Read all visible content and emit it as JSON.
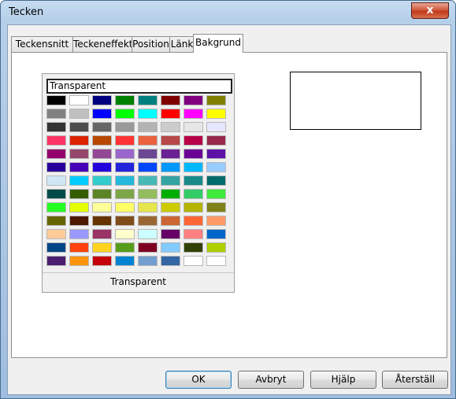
{
  "window": {
    "title": "Tecken",
    "close_glyph": "x"
  },
  "tabs": [
    "Teckensnitt",
    "Teckeneffekt",
    "Position",
    "Länk",
    "Bakgrund"
  ],
  "active_tab": "Bakgrund",
  "palette": {
    "selected_label": "Transparent",
    "bottom_label": "Transparent",
    "rows": [
      [
        "#000000",
        "#ffffff",
        "#000080",
        "#008000",
        "#008080",
        "#800000",
        "#800080",
        "#808000"
      ],
      [
        "#808080",
        "#c0c0c0",
        "#0000ff",
        "#00ff00",
        "#00ffff",
        "#ff0000",
        "#ff00ff",
        "#ffff00"
      ],
      [
        "#333333",
        "#4d4d4d",
        "#666666",
        "#999999",
        "#b3b3b3",
        "#cccccc",
        "#e6e6e6",
        "#e6e6ff"
      ],
      [
        "#ff3366",
        "#dc2300",
        "#b84700",
        "#ff3333",
        "#eb613d",
        "#b84747",
        "#b80047",
        "#99284c"
      ],
      [
        "#94006b",
        "#94476b",
        "#944794",
        "#9966cc",
        "#6b4794",
        "#6b2394",
        "#6b0094",
        "#5e11a6"
      ],
      [
        "#280099",
        "#4700b8",
        "#2300dc",
        "#2323dc",
        "#0047ff",
        "#0099ff",
        "#00b8ff",
        "#99ccff"
      ],
      [
        "#cfe7f5",
        "#00ccff",
        "#33cccc",
        "#23b8dc",
        "#47b8b8",
        "#33a3a3",
        "#198a8a",
        "#006b6b"
      ],
      [
        "#004a4a",
        "#355e00",
        "#5c8526",
        "#7da647",
        "#94bd5e",
        "#00ae00",
        "#33cc66",
        "#3deb3d"
      ],
      [
        "#23ff23",
        "#e6ff00",
        "#ffff99",
        "#ffff66",
        "#e6e64c",
        "#cccc00",
        "#b3b300",
        "#808019"
      ],
      [
        "#666600",
        "#4c1900",
        "#663300",
        "#804c19",
        "#996633",
        "#cc6633",
        "#ff6633",
        "#ff9966"
      ],
      [
        "#ffcc99",
        "#9999ff",
        "#993366",
        "#ffffcc",
        "#ccffff",
        "#660066",
        "#ff8080",
        "#0066cc"
      ],
      [
        "#004586",
        "#ff420e",
        "#ffd320",
        "#579d1c",
        "#7e0021",
        "#83caff",
        "#314004",
        "#aecf00"
      ],
      [
        "#4b1f6f",
        "#ff950e",
        "#c5000b",
        "#0084d1",
        "#729fcf",
        "#3465a4",
        "#ffffff",
        "#ffffff"
      ]
    ]
  },
  "buttons": {
    "ok": "OK",
    "cancel": "Avbryt",
    "help": "Hjälp",
    "reset": "Återställ"
  }
}
